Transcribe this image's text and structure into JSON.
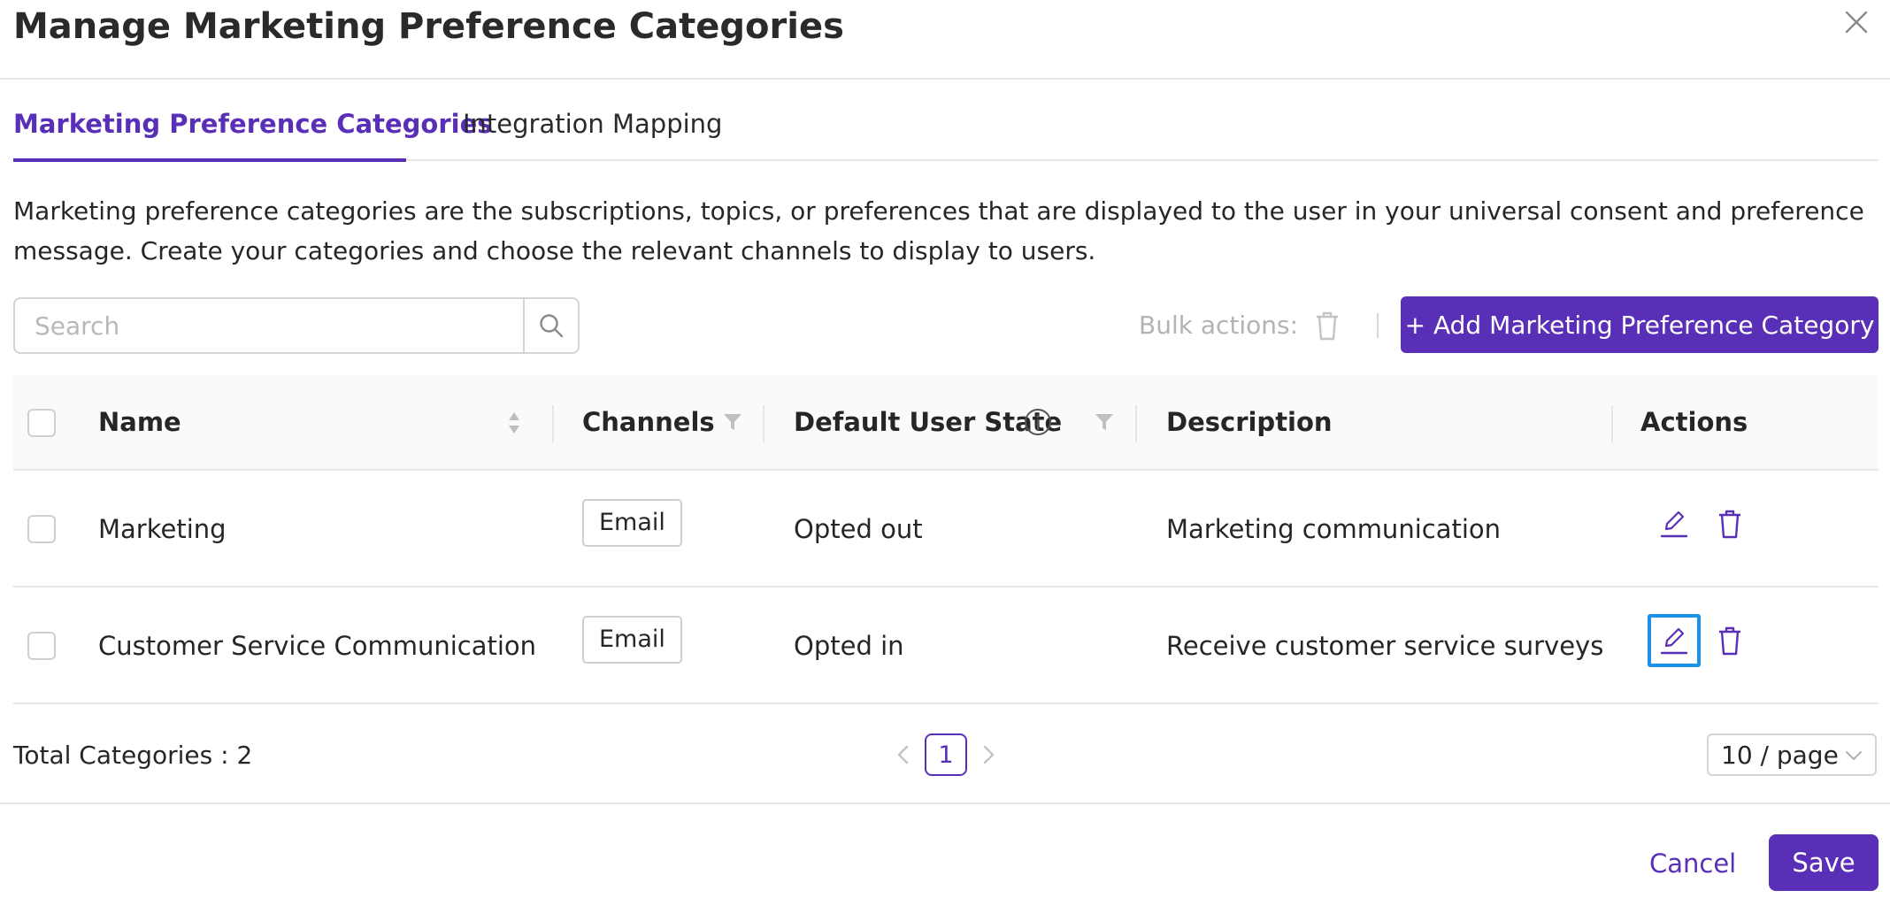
{
  "dialog": {
    "title": "Manage Marketing Preference Categories"
  },
  "tabs": [
    {
      "label": "Marketing Preference Categories",
      "active": true
    },
    {
      "label": "Integration Mapping",
      "active": false
    }
  ],
  "description": "Marketing preference categories are the subscriptions, topics, or preferences that are displayed to the user in your universal consent and preference message. Create your categories and choose the relevant channels to display to users.",
  "toolbar": {
    "search_placeholder": "Search",
    "bulk_actions_label": "Bulk actions:",
    "add_button_label": "+ Add Marketing Preference Category"
  },
  "table": {
    "columns": [
      "Name",
      "Channels",
      "Default User State",
      "Description",
      "Actions"
    ],
    "rows": [
      {
        "name": "Marketing",
        "channel": "Email",
        "default_state": "Opted out",
        "description": "Marketing communication"
      },
      {
        "name": "Customer Service Communication",
        "channel": "Email",
        "default_state": "Opted in",
        "description": "Receive customer service surveys"
      }
    ]
  },
  "pagination": {
    "total_label": "Total Categories : 2",
    "current_page": "1",
    "page_size": "10 / page"
  },
  "footer": {
    "cancel_label": "Cancel",
    "save_label": "Save"
  },
  "colors": {
    "accent": "#5a2fb8",
    "focus": "#1e90e8",
    "border": "#e6e6e6"
  },
  "icons": [
    "close-icon",
    "search-icon",
    "trash-icon",
    "sort-icon",
    "filter-icon",
    "info-icon",
    "edit-icon",
    "chevron-left-icon",
    "chevron-right-icon",
    "chevron-down-icon"
  ]
}
